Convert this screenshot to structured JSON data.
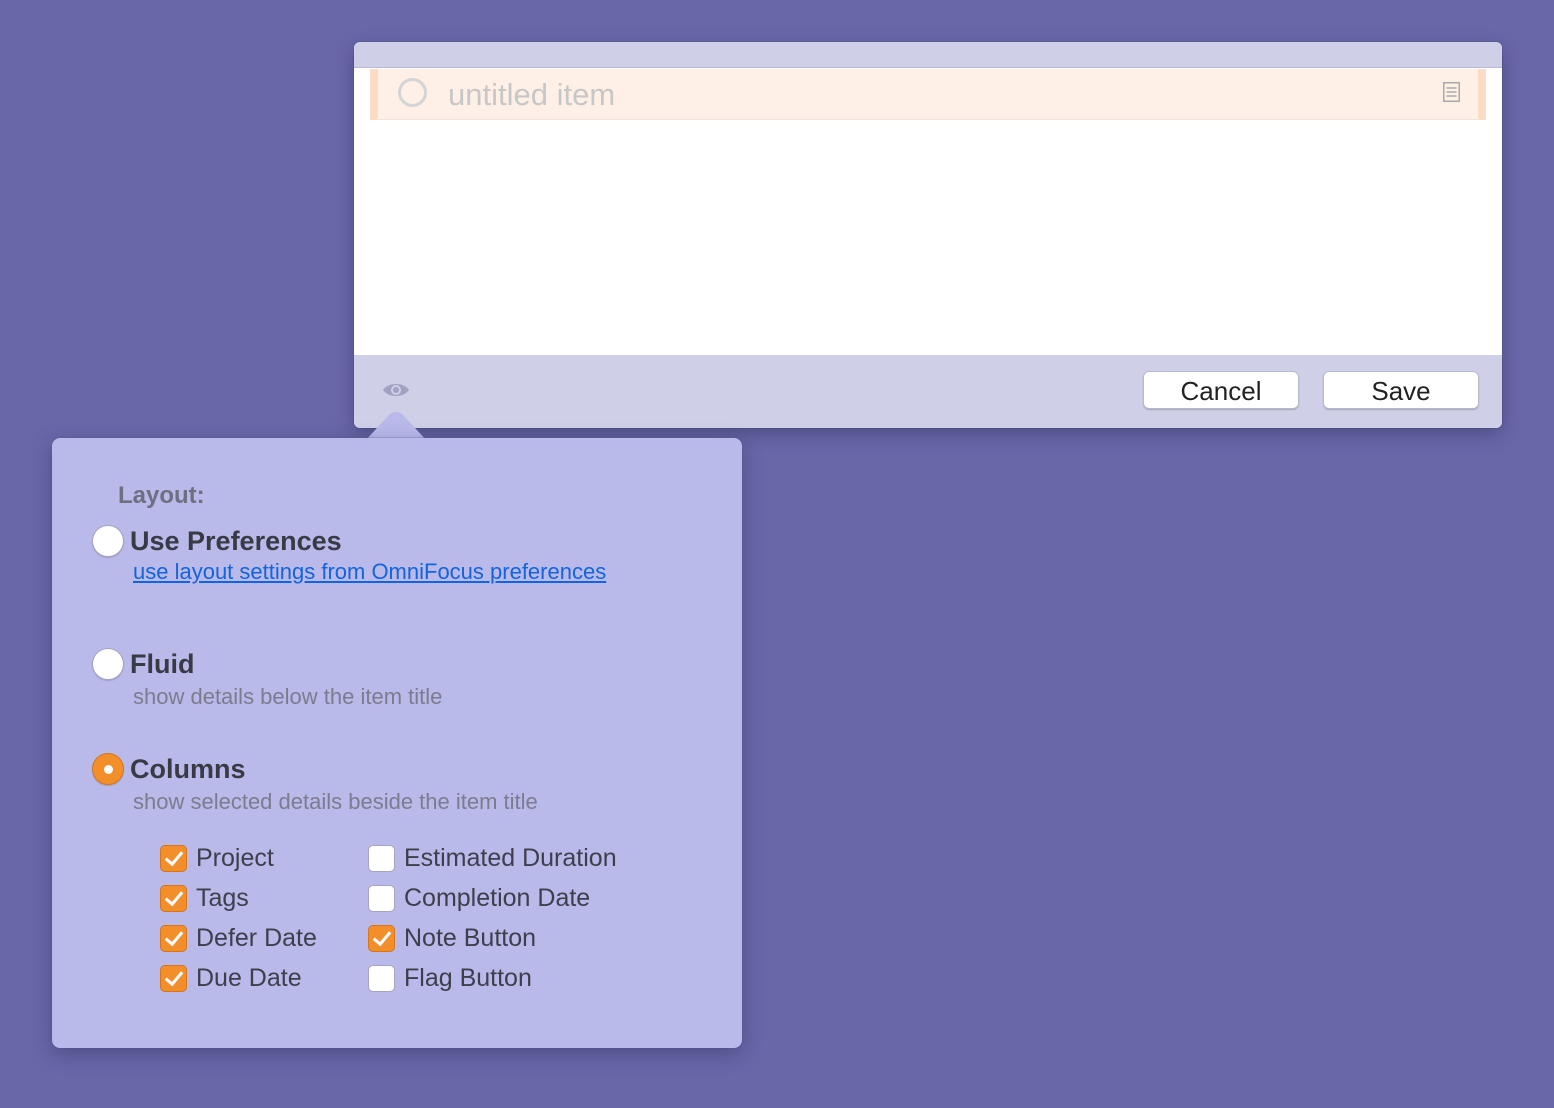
{
  "window": {
    "item": {
      "title_placeholder": "untitled item"
    },
    "footer": {
      "view_options_icon": "eye-icon",
      "cancel_label": "Cancel",
      "save_label": "Save"
    }
  },
  "popover": {
    "section_label": "Layout:",
    "options": [
      {
        "title": "Use Preferences",
        "description": "use layout settings from OmniFocus preferences",
        "description_is_link": true,
        "selected": false
      },
      {
        "title": "Fluid",
        "description": "show details below the item title",
        "selected": false
      },
      {
        "title": "Columns",
        "description": "show selected details beside the item title",
        "selected": true
      }
    ],
    "columns": [
      {
        "label": "Project",
        "checked": true
      },
      {
        "label": "Tags",
        "checked": true
      },
      {
        "label": "Defer Date",
        "checked": true
      },
      {
        "label": "Due Date",
        "checked": true
      },
      {
        "label": "Estimated Duration",
        "checked": false
      },
      {
        "label": "Completion Date",
        "checked": false
      },
      {
        "label": "Note Button",
        "checked": true
      },
      {
        "label": "Flag Button",
        "checked": false
      }
    ]
  },
  "colors": {
    "desktop": "#6868a9",
    "accent": "#f28f2b",
    "link": "#1464dc",
    "row_highlight": "#fef0e6",
    "popover_bg": "#b9b9ea"
  }
}
